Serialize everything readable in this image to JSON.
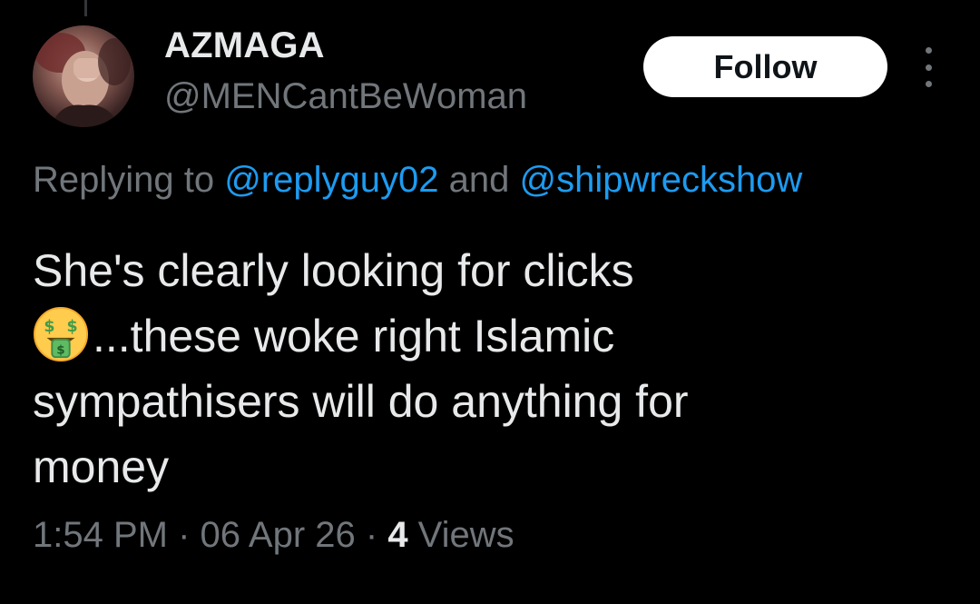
{
  "author": {
    "display_name": "AZMAGA",
    "handle": "@MENCantBeWoman",
    "avatar_icon": "profile-photo"
  },
  "actions": {
    "follow_label": "Follow",
    "more_icon": "more-vertical-icon"
  },
  "reply": {
    "prefix": "Replying to ",
    "mention_1": "@replyguy02",
    "conjunction": " and ",
    "mention_2": "@shipwreckshow"
  },
  "tweet": {
    "line_1": "She's clearly looking for clicks",
    "emoji": "money-mouth-face-emoji",
    "line_2": "...these woke right Islamic",
    "line_3": "sympathisers will do anything for",
    "line_4": "money"
  },
  "meta": {
    "time": "1:54 PM",
    "separator": " · ",
    "date": "06 Apr 26",
    "views_count": "4",
    "views_label": " Views"
  },
  "colors": {
    "background": "#000000",
    "text_primary": "#e7e9ea",
    "text_secondary": "#71767b",
    "link": "#1d9bf0",
    "button_bg": "#ffffff"
  }
}
